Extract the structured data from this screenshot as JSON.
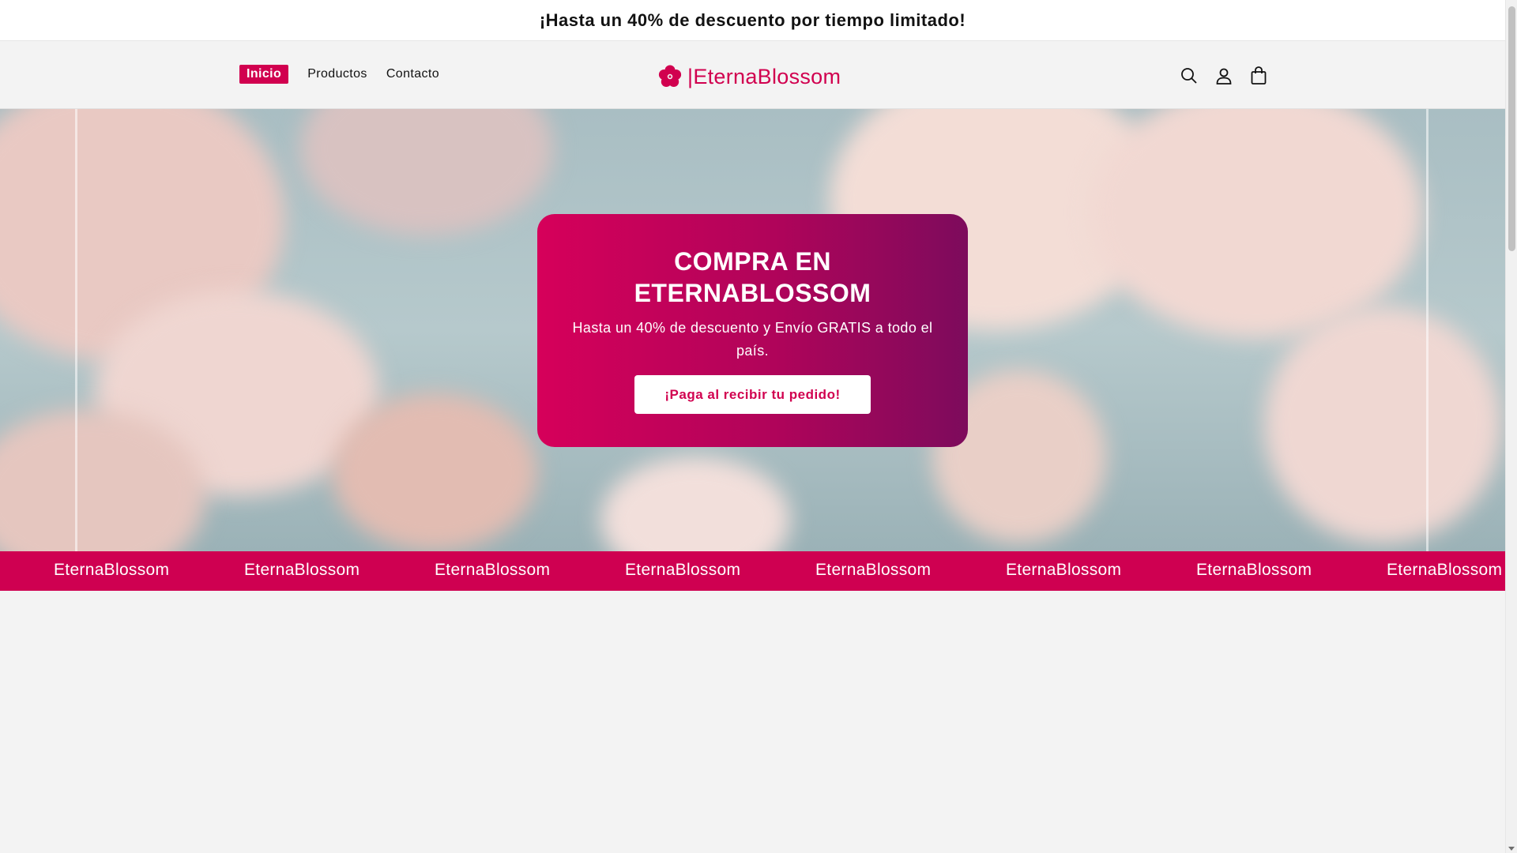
{
  "announcement": "¡Hasta un 40% de descuento por tiempo limitado!",
  "nav": {
    "items": [
      {
        "label": "Inicio",
        "active": true
      },
      {
        "label": "Productos",
        "active": false
      },
      {
        "label": "Contacto",
        "active": false
      }
    ]
  },
  "logo": {
    "text": "|EternaBlossom",
    "icon": "flower-icon"
  },
  "header_icons": [
    "search-icon",
    "account-icon",
    "cart-icon"
  ],
  "hero": {
    "title": "COMPRA EN ETERNABLOSSOM",
    "subtitle": "Hasta un 40% de descuento y Envío GRATIS a todo el país.",
    "button_label": "¡Paga al recibir tu pedido!"
  },
  "marquee": {
    "items": [
      "EternaBlossom",
      "EternaBlossom",
      "EternaBlossom",
      "EternaBlossom",
      "EternaBlossom",
      "EternaBlossom",
      "EternaBlossom",
      "EternaBlossom"
    ]
  },
  "colors": {
    "brand": "#d1004f",
    "background": "#f3f3f3"
  }
}
